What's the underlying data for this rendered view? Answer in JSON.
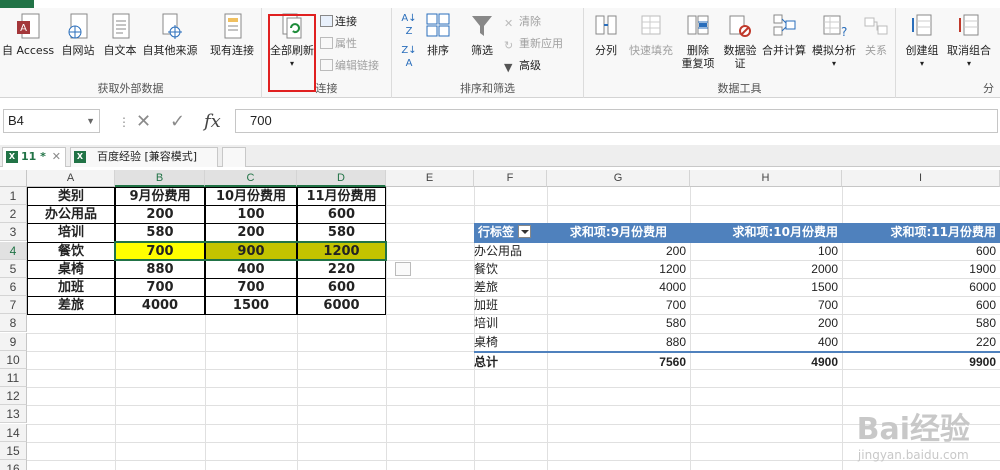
{
  "ribbon": {
    "file_tab_color": "#217346",
    "groups": {
      "get_external": {
        "label": "获取外部数据",
        "buttons": [
          "自 Access",
          "自网站",
          "自文本",
          "自其他来源",
          "现有连接"
        ]
      },
      "connections": {
        "label": "连接",
        "refresh_all": "全部刷新",
        "connections": "连接",
        "properties": "属性",
        "edit_links": "编辑链接"
      },
      "sort_filter": {
        "label": "排序和筛选",
        "sort": "排序",
        "filter": "筛选",
        "clear": "清除",
        "reapply": "重新应用",
        "advanced": "高级"
      },
      "data_tools": {
        "label": "数据工具",
        "split": "分列",
        "flash_fill": "快速填充",
        "remove_dup_1": "删除",
        "remove_dup_2": "重复项",
        "validation_1": "数据验",
        "validation_2": "证",
        "consolidate": "合并计算",
        "what_if": "模拟分析",
        "relationships": "关系"
      },
      "outline": {
        "label": "分",
        "group": "创建组",
        "ungroup": "取消组合"
      }
    }
  },
  "formula_bar": {
    "name_box": "B4",
    "value": "700"
  },
  "workbook_tabs": [
    {
      "label": "11 *",
      "active": true
    },
    {
      "label": "百度经验  [兼容模式]",
      "active": false
    }
  ],
  "columns": [
    "A",
    "B",
    "C",
    "D",
    "E",
    "F",
    "G",
    "H",
    "I"
  ],
  "rows": [
    "1",
    "2",
    "3",
    "4",
    "5",
    "6",
    "7",
    "8",
    "9",
    "10",
    "11",
    "12",
    "13",
    "14",
    "15",
    "16"
  ],
  "table1": {
    "header": [
      "类别",
      "9月份费用",
      "10月份费用",
      "11月份费用"
    ],
    "rows": [
      [
        "办公用品",
        "200",
        "100",
        "600"
      ],
      [
        "培训",
        "580",
        "200",
        "580"
      ],
      [
        "餐饮",
        "700",
        "900",
        "1200"
      ],
      [
        "桌椅",
        "880",
        "400",
        "220"
      ],
      [
        "加班",
        "700",
        "700",
        "600"
      ],
      [
        "差旅",
        "4000",
        "1500",
        "6000"
      ]
    ],
    "highlight_row_colors": [
      "#ffff00",
      "#c3c300"
    ]
  },
  "pivot": {
    "header": [
      "行标签",
      "求和项:9月份费用",
      "求和项:10月份费用",
      "求和项:11月份费用"
    ],
    "rows": [
      [
        "办公用品",
        "200",
        "100",
        "600"
      ],
      [
        "餐饮",
        "1200",
        "2000",
        "1900"
      ],
      [
        "差旅",
        "4000",
        "1500",
        "6000"
      ],
      [
        "加班",
        "700",
        "700",
        "600"
      ],
      [
        "培训",
        "580",
        "200",
        "580"
      ],
      [
        "桌椅",
        "880",
        "400",
        "220"
      ]
    ],
    "total": [
      "总计",
      "7560",
      "4900",
      "9900"
    ],
    "header_color": "#4f81bd"
  },
  "watermark": {
    "big": "Bai经验",
    "small": "jingyan.baidu.com"
  }
}
